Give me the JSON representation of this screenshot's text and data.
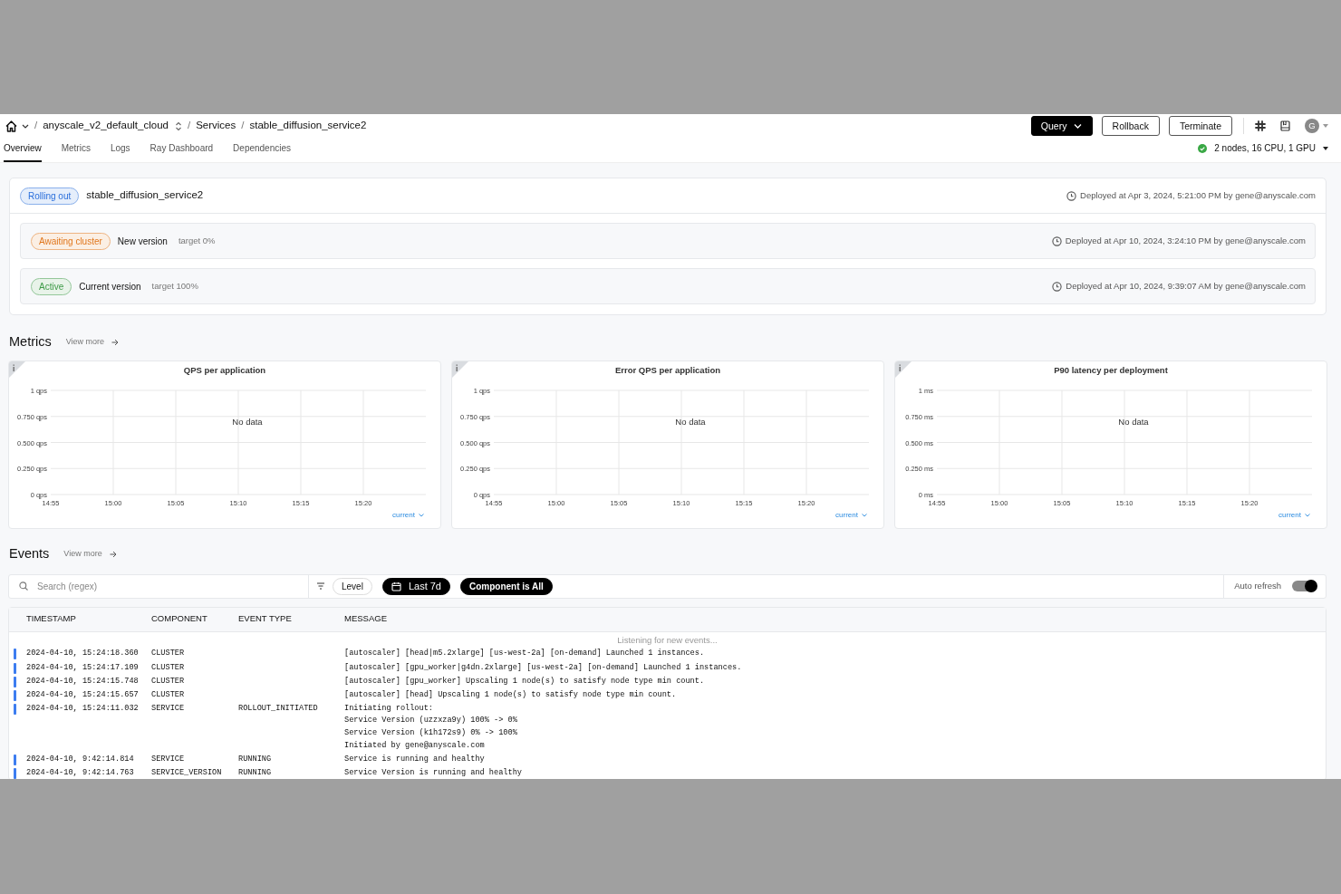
{
  "breadcrumb": {
    "separator": "/",
    "items": [
      {
        "label": "anyscale_v2_default_cloud",
        "kind": "switcher"
      },
      {
        "label": "Services",
        "kind": "link"
      },
      {
        "label": "stable_diffusion_service2",
        "kind": "current"
      }
    ]
  },
  "actions": [
    {
      "label": "Query",
      "kind": "dropdown"
    },
    {
      "label": "Rollback",
      "kind": "outline"
    },
    {
      "label": "Terminate",
      "kind": "outline"
    }
  ],
  "avatar": "G",
  "tabs": [
    {
      "label": "Overview",
      "selected": true
    },
    {
      "label": "Metrics",
      "selected": false
    },
    {
      "label": "Logs",
      "selected": false
    },
    {
      "label": "Ray Dashboard",
      "selected": false
    },
    {
      "label": "Dependencies",
      "selected": false
    }
  ],
  "cluster_status": {
    "text": "2 nodes, 16 CPU, 1 GPU",
    "healthy": true
  },
  "service": {
    "status": "Rolling out",
    "color": "#2a6fdb",
    "name": "stable_diffusion_service2",
    "deployed": "Deployed at Apr 3, 2024, 5:21:00 PM by gene@anyscale.com",
    "versions": [
      {
        "status": "Awaiting cluster",
        "color": "#e0761c",
        "name": "New version",
        "target": "target 0%",
        "deployed": "Deployed at Apr 10, 2024, 3:24:10 PM by gene@anyscale.com"
      },
      {
        "status": "Active",
        "color": "#3d9a47",
        "name": "Current version",
        "target": "target 100%",
        "deployed": "Deployed at Apr 10, 2024, 9:39:07 AM by gene@anyscale.com"
      }
    ]
  },
  "metrics": {
    "title": "Metrics",
    "view_more": "View more",
    "charts": [
      {
        "empty_text": "No data",
        "legend_toggle": "current",
        "chart_data": {
          "type": "line",
          "title": "QPS per application",
          "grid": true,
          "categories": [
            "14:55",
            "15:00",
            "15:05",
            "15:10",
            "15:15",
            "15:20"
          ],
          "ylim": [
            0,
            1
          ],
          "yticks": [
            {
              "value": 0,
              "label": "0 qps"
            },
            {
              "value": 0.25,
              "label": "0.250 qps"
            },
            {
              "value": 0.5,
              "label": "0.500 qps"
            },
            {
              "value": 0.75,
              "label": "0.750 qps"
            },
            {
              "value": 1,
              "label": "1 qps"
            }
          ]
        }
      },
      {
        "empty_text": "No data",
        "legend_toggle": "current",
        "chart_data": {
          "type": "line",
          "title": "Error QPS per application",
          "grid": true,
          "categories": [
            "14:55",
            "15:00",
            "15:05",
            "15:10",
            "15:15",
            "15:20"
          ],
          "ylim": [
            0,
            1
          ],
          "yticks": [
            {
              "value": 0,
              "label": "0 qps"
            },
            {
              "value": 0.25,
              "label": "0.250 qps"
            },
            {
              "value": 0.5,
              "label": "0.500 qps"
            },
            {
              "value": 0.75,
              "label": "0.750 qps"
            },
            {
              "value": 1,
              "label": "1 qps"
            }
          ]
        }
      },
      {
        "empty_text": "No data",
        "legend_toggle": "current",
        "chart_data": {
          "type": "line",
          "title": "P90 latency per deployment",
          "grid": true,
          "categories": [
            "14:55",
            "15:00",
            "15:05",
            "15:10",
            "15:15",
            "15:20"
          ],
          "ylim": [
            0,
            1
          ],
          "yticks": [
            {
              "value": 0,
              "label": "0 ms"
            },
            {
              "value": 0.25,
              "label": "0.250 ms"
            },
            {
              "value": 0.5,
              "label": "0.500 ms"
            },
            {
              "value": 0.75,
              "label": "0.750 ms"
            },
            {
              "value": 1,
              "label": "1 ms"
            }
          ]
        }
      }
    ]
  },
  "events": {
    "title": "Events",
    "view_more": "View more",
    "search": {
      "placeholder": "Search (regex)"
    },
    "filters": [
      {
        "label": "Level",
        "kind": "outline"
      },
      {
        "label": "Last 7d",
        "kind": "date"
      },
      {
        "label": "Component is **All**",
        "kind": "dark"
      }
    ],
    "auto_refresh": {
      "label": "Auto refresh",
      "on": true
    },
    "columns": [
      "TIMESTAMP",
      "COMPONENT",
      "EVENT TYPE",
      "MESSAGE"
    ],
    "listening": "Listening for new events...",
    "rows": [
      {
        "timestamp": "2024-04-10, 15:24:18.360",
        "component": "CLUSTER",
        "message": [
          "[autoscaler] [head|m5.2xlarge] [us-west-2a] [on-demand] Launched 1 instances."
        ]
      },
      {
        "timestamp": "2024-04-10, 15:24:17.109",
        "component": "CLUSTER",
        "message": [
          "[autoscaler] [gpu_worker|g4dn.2xlarge] [us-west-2a] [on-demand] Launched 1 instances."
        ]
      },
      {
        "timestamp": "2024-04-10, 15:24:15.748",
        "component": "CLUSTER",
        "message": [
          "[autoscaler] [gpu_worker] Upscaling 1 node(s) to satisfy node type min count."
        ]
      },
      {
        "timestamp": "2024-04-10, 15:24:15.657",
        "component": "CLUSTER",
        "message": [
          "[autoscaler] [head] Upscaling 1 node(s) to satisfy node type min count."
        ]
      },
      {
        "timestamp": "2024-04-10, 15:24:11.032",
        "component": "SERVICE",
        "event_type": "ROLLOUT_INITIATED",
        "message": [
          "Initiating rollout:",
          "Service Version (uzzxza9y) 100% -> 0%",
          "Service Version (k1h172s9) 0% -> 100%",
          "Initiated by gene@anyscale.com"
        ]
      },
      {
        "timestamp": "2024-04-10, 9:42:14.814",
        "component": "SERVICE",
        "event_type": "RUNNING",
        "message": [
          "Service is running and healthy"
        ]
      },
      {
        "timestamp": "2024-04-10, 9:42:14.763",
        "component": "SERVICE_VERSION",
        "event_type": "RUNNING",
        "message": [
          "Service Version is running and healthy"
        ]
      }
    ]
  }
}
